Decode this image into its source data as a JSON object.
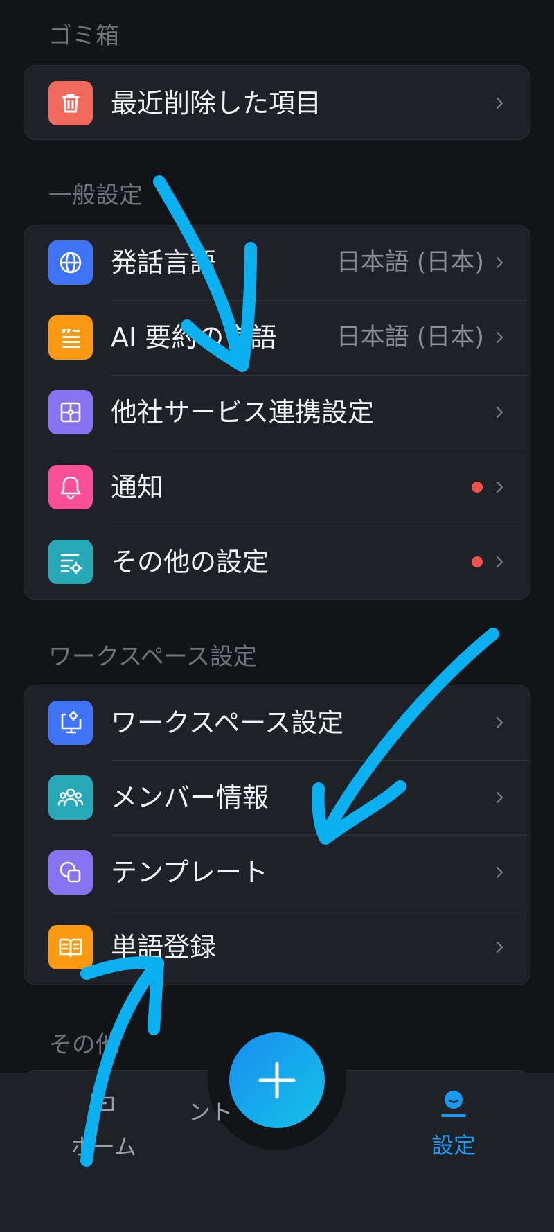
{
  "sections": {
    "trash": "ゴミ箱",
    "general": "一般設定",
    "workspace": "ワークスペース設定",
    "other": "その他"
  },
  "trash_items": [
    {
      "label": "最近削除した項目",
      "icon": "trash-icon",
      "color": "#ef6a5c"
    }
  ],
  "general_items": [
    {
      "label": "発話言語",
      "value": "日本語 (日本)",
      "icon": "globe-icon",
      "color": "#3f73f5"
    },
    {
      "label": "AI 要約の言語",
      "value": "日本語 (日本)",
      "icon": "quote-text-icon",
      "color": "#fb9a10"
    },
    {
      "label": "他社サービス連携設定",
      "icon": "puzzle-icon",
      "color": "#8772f0"
    },
    {
      "label": "通知",
      "badge": "#f0514c",
      "icon": "bell-icon",
      "color": "#fb4f97"
    },
    {
      "label": "その他の設定",
      "badge": "#f0514c",
      "icon": "settings-list-icon",
      "color": "#27a8b8"
    }
  ],
  "workspace_items": [
    {
      "label": "ワークスペース設定",
      "icon": "monitor-gear-icon",
      "color": "#3f73f5"
    },
    {
      "label": "メンバー情報",
      "icon": "members-icon",
      "color": "#27a8b8"
    },
    {
      "label": "テンプレート",
      "icon": "shapes-icon",
      "color": "#8772f0"
    },
    {
      "label": "単語登録",
      "icon": "book-icon",
      "color": "#fb9a10"
    }
  ],
  "tabbar": {
    "home": "ホーム",
    "center_partial": "ント",
    "settings": "設定",
    "active_color": "#1a9af2",
    "add_icon": "plus-icon"
  }
}
